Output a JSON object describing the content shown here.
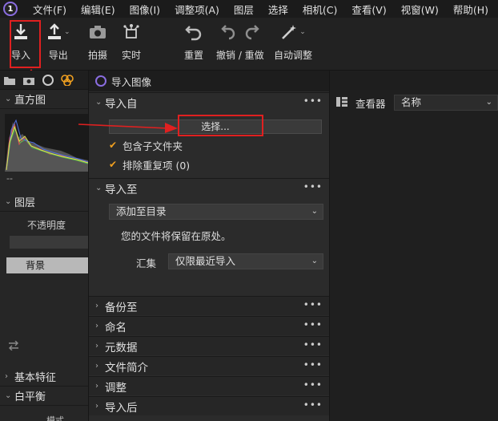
{
  "menu": [
    "文件(F)",
    "编辑(E)",
    "图像(I)",
    "调整项(A)",
    "图层",
    "选择",
    "相机(C)",
    "查看(V)",
    "视窗(W)",
    "帮助(H)"
  ],
  "toolbar": {
    "import": "导入",
    "export": "导出",
    "capture": "拍摄",
    "live": "实时",
    "reset": "重置",
    "undo_redo": "撤销 / 重做",
    "auto_adjust": "自动调整"
  },
  "left_panel": {
    "histogram": "直方图",
    "hist_dash": "--",
    "layers": "图层",
    "opacity": "不透明度",
    "background_layer": "背景",
    "base_characteristics": "基本特征",
    "white_balance": "白平衡",
    "mode": "模式"
  },
  "dialog": {
    "title": "导入图像",
    "import_from": "导入自",
    "choose": "选择...",
    "include_subfolders": "包含子文件夹",
    "exclude_duplicates": "排除重复项 (0)",
    "import_to": "导入至",
    "destination": "添加至目录",
    "files_stay": "您的文件将保留在原处。",
    "collection_label": "汇集",
    "collection_value": "仅限最近导入",
    "sections": [
      "备份至",
      "命名",
      "元数据",
      "文件简介",
      "调整",
      "导入后"
    ],
    "more": "•••"
  },
  "viewer": {
    "label": "查看器",
    "sort": "名称"
  },
  "colors": {
    "highlight": "#e02020",
    "checkbox": "#f0a020",
    "accent": "#8a6de0"
  }
}
